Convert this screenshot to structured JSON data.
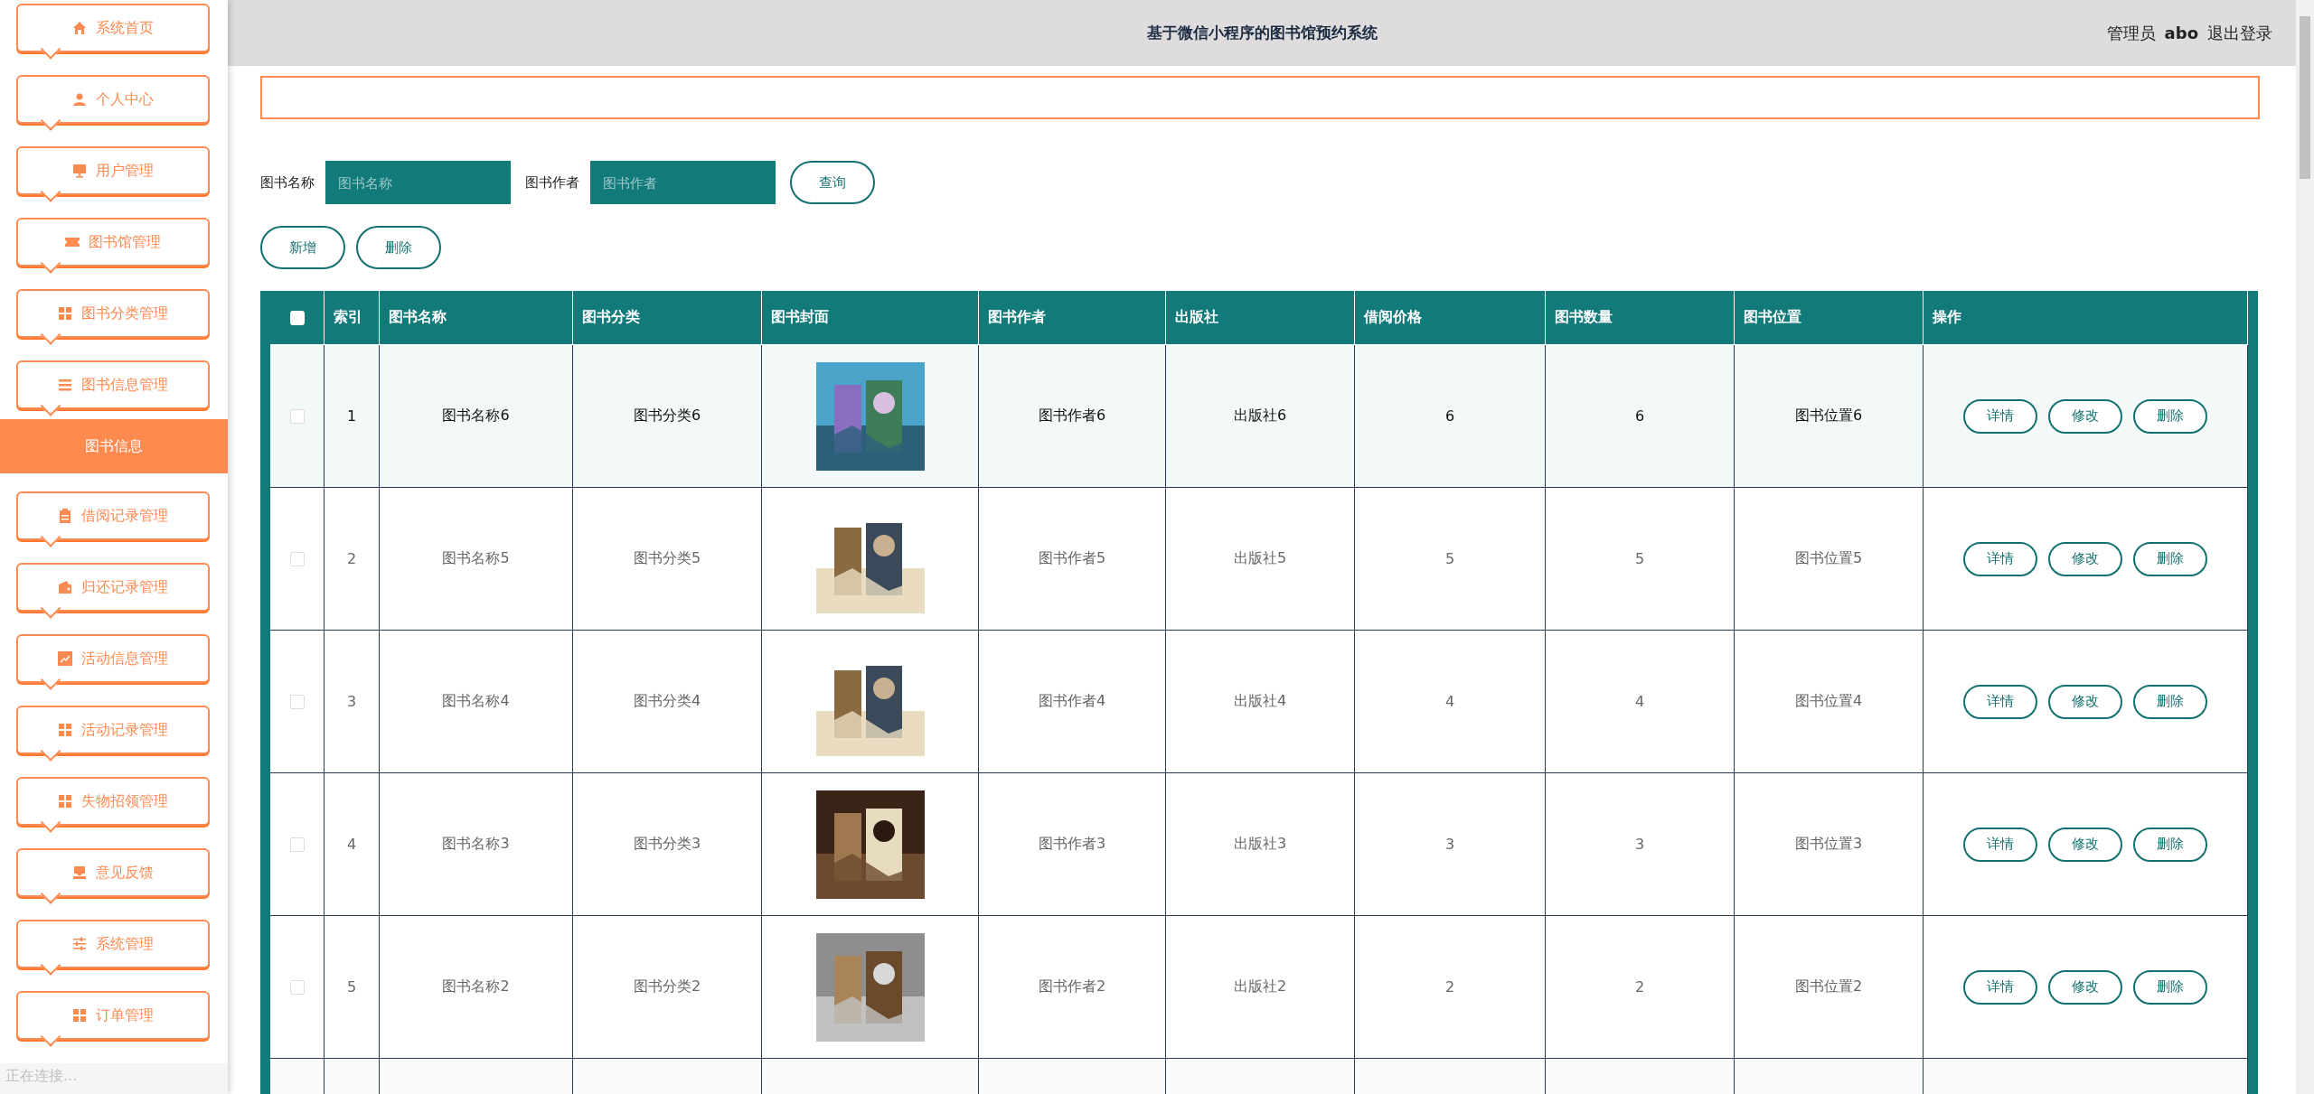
{
  "sidebar": {
    "items": [
      {
        "label": "系统首页",
        "kind": "menu",
        "selected": false
      },
      {
        "label": "个人中心",
        "kind": "menu",
        "selected": false
      },
      {
        "label": "用户管理",
        "kind": "menu",
        "selected": false
      },
      {
        "label": "图书馆管理",
        "kind": "menu",
        "selected": false
      },
      {
        "label": "图书分类管理",
        "kind": "menu",
        "selected": false
      },
      {
        "label": "图书信息管理",
        "kind": "menu",
        "selected": false
      },
      {
        "label": "图书信息",
        "kind": "submenu",
        "selected": true
      },
      {
        "label": "借阅记录管理",
        "kind": "menu",
        "selected": false
      },
      {
        "label": "归还记录管理",
        "kind": "menu",
        "selected": false
      },
      {
        "label": "活动信息管理",
        "kind": "menu",
        "selected": false
      },
      {
        "label": "活动记录管理",
        "kind": "menu",
        "selected": false
      },
      {
        "label": "失物招领管理",
        "kind": "menu",
        "selected": false
      },
      {
        "label": "意见反馈",
        "kind": "menu",
        "selected": false
      },
      {
        "label": "系统管理",
        "kind": "menu",
        "selected": false
      },
      {
        "label": "订单管理",
        "kind": "menu",
        "selected": false
      }
    ]
  },
  "status_bar": "正在连接...",
  "header": {
    "title": "基于微信小程序的图书馆预约系统",
    "role": "管理员",
    "user": "abo",
    "logout": "退出登录"
  },
  "search": {
    "fields": [
      {
        "label": "图书名称",
        "placeholder": "图书名称"
      },
      {
        "label": "图书作者",
        "placeholder": "图书作者"
      }
    ],
    "button": "查询"
  },
  "actions": [
    "新增",
    "删除"
  ],
  "table": {
    "select_all": {
      "checked": false
    },
    "columns": [
      "索引",
      "图书名称",
      "图书分类",
      "图书封面",
      "图书作者",
      "出版社",
      "借阅价格",
      "图书数量",
      "图书位置",
      "操作"
    ],
    "rows": [
      {
        "checked": false,
        "highlighted": true,
        "cells": [
          "1",
          "图书名称6",
          "图书分类6",
          "",
          "图书作者6",
          "出版社6",
          "6",
          "6",
          "图书位置6"
        ],
        "cover": {
          "kind": "picture"
        },
        "buttons": [
          "详情",
          "修改",
          "删除"
        ]
      },
      {
        "checked": false,
        "highlighted": false,
        "cells": [
          "2",
          "图书名称5",
          "图书分类5",
          "",
          "图书作者5",
          "出版社5",
          "5",
          "5",
          "图书位置5"
        ],
        "cover": {
          "kind": "picture"
        },
        "buttons": [
          "详情",
          "修改",
          "删除"
        ]
      },
      {
        "checked": false,
        "highlighted": false,
        "cells": [
          "3",
          "图书名称4",
          "图书分类4",
          "",
          "图书作者4",
          "出版社4",
          "4",
          "4",
          "图书位置4"
        ],
        "cover": {
          "kind": "picture"
        },
        "buttons": [
          "详情",
          "修改",
          "删除"
        ]
      },
      {
        "checked": false,
        "highlighted": false,
        "cells": [
          "4",
          "图书名称3",
          "图书分类3",
          "",
          "图书作者3",
          "出版社3",
          "3",
          "3",
          "图书位置3"
        ],
        "cover": {
          "kind": "picture"
        },
        "buttons": [
          "详情",
          "修改",
          "删除"
        ]
      },
      {
        "checked": false,
        "highlighted": false,
        "cells": [
          "5",
          "图书名称2",
          "图书分类2",
          "",
          "图书作者2",
          "出版社2",
          "2",
          "2",
          "图书位置2"
        ],
        "cover": {
          "kind": "picture"
        },
        "buttons": [
          "详情",
          "修改",
          "删除"
        ]
      }
    ]
  }
}
